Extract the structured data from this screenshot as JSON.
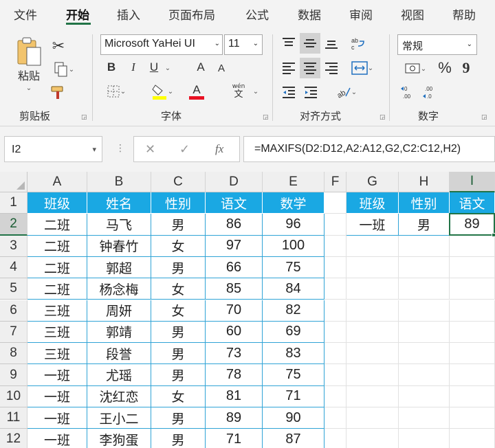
{
  "tabs": [
    {
      "label": "文件"
    },
    {
      "label": "开始"
    },
    {
      "label": "插入"
    },
    {
      "label": "页面布局"
    },
    {
      "label": "公式"
    },
    {
      "label": "数据"
    },
    {
      "label": "审阅"
    },
    {
      "label": "视图"
    },
    {
      "label": "帮助"
    }
  ],
  "active_tab": "开始",
  "ribbon": {
    "clipboard": {
      "paste_label": "粘贴",
      "group_label": "剪贴板"
    },
    "font": {
      "font_name": "Microsoft YaHei UI",
      "font_size": "11",
      "bold": "B",
      "italic": "I",
      "underline": "U",
      "grow": "A",
      "shrink": "A",
      "font_color_letter": "A",
      "phonetic_top": "wén",
      "phonetic_bottom": "文",
      "group_label": "字体"
    },
    "alignment": {
      "group_label": "对齐方式"
    },
    "number": {
      "format": "常规",
      "percent": "%",
      "comma": "9",
      "group_label": "数字"
    }
  },
  "colors": {
    "accent": "#217346",
    "table_header": "#1aa8e3",
    "table_border": "#2ea3d6",
    "font_color_bar": "#e81123",
    "fill_color_bar": "#ffff00"
  },
  "formula_bar": {
    "name_box": "I2",
    "fx": "fx",
    "formula": "=MAXIFS(D2:D12,A2:A12,G2,C2:C12,H2)"
  },
  "columns": [
    "A",
    "B",
    "C",
    "D",
    "E",
    "F",
    "G",
    "H",
    "I"
  ],
  "rows": [
    "1",
    "2",
    "3",
    "4",
    "5",
    "6",
    "7",
    "8",
    "9",
    "10",
    "11",
    "12"
  ],
  "main_table": {
    "headers": [
      "班级",
      "姓名",
      "性别",
      "语文",
      "数学"
    ],
    "rows": [
      [
        "二班",
        "马飞",
        "男",
        "86",
        "96"
      ],
      [
        "二班",
        "钟春竹",
        "女",
        "97",
        "100"
      ],
      [
        "二班",
        "郭超",
        "男",
        "66",
        "75"
      ],
      [
        "二班",
        "杨念梅",
        "女",
        "85",
        "84"
      ],
      [
        "三班",
        "周妍",
        "女",
        "70",
        "82"
      ],
      [
        "三班",
        "郭靖",
        "男",
        "60",
        "69"
      ],
      [
        "三班",
        "段誉",
        "男",
        "73",
        "83"
      ],
      [
        "一班",
        "尤瑶",
        "男",
        "78",
        "75"
      ],
      [
        "一班",
        "沈红恋",
        "女",
        "81",
        "71"
      ],
      [
        "一班",
        "王小二",
        "男",
        "89",
        "90"
      ],
      [
        "一班",
        "李狗蛋",
        "男",
        "71",
        "87"
      ]
    ]
  },
  "criteria_table": {
    "headers": [
      "班级",
      "性别",
      "语文"
    ],
    "row": [
      "一班",
      "男",
      "89"
    ]
  },
  "active_cell": "I2"
}
